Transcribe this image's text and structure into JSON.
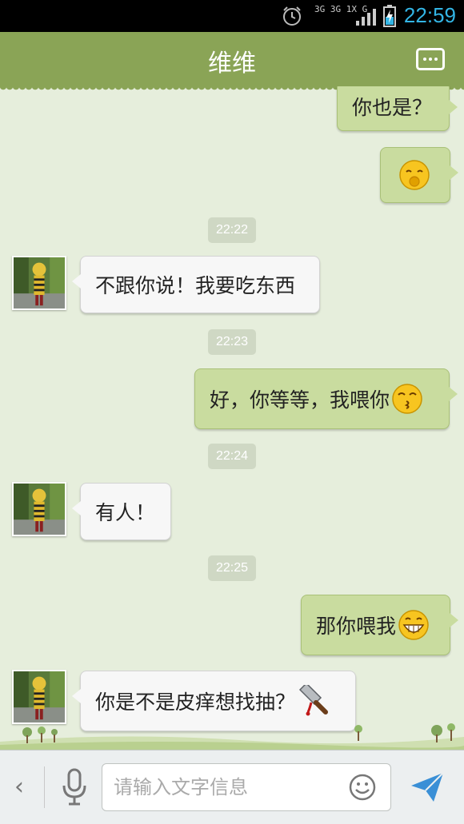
{
  "status_bar": {
    "time": "22:59",
    "network": "3G 3G 1X G",
    "icons": [
      "alarm-icon",
      "signal-icon",
      "battery-charging-icon"
    ]
  },
  "header": {
    "title": "维维",
    "menu_icon": "chat-menu-icon"
  },
  "messages": [
    {
      "type": "out",
      "text": "你也是？",
      "emoji": null
    },
    {
      "type": "out",
      "text": "",
      "emoji": "shy-smile-emoji"
    },
    {
      "type": "time",
      "text": "22:22"
    },
    {
      "type": "in",
      "text": "不跟你说！我要吃东西",
      "emoji": null
    },
    {
      "type": "time",
      "text": "22:23"
    },
    {
      "type": "out",
      "text": "好，你等等，我喂你",
      "emoji": "kiss-emoji"
    },
    {
      "type": "time",
      "text": "22:24"
    },
    {
      "type": "in",
      "text": "有人！",
      "emoji": null
    },
    {
      "type": "time",
      "text": "22:25"
    },
    {
      "type": "out",
      "text": "那你喂我",
      "emoji": "grin-emoji"
    },
    {
      "type": "in",
      "text": "你是不是皮痒想找抽？",
      "emoji": "cleaver-emoji"
    }
  ],
  "input_bar": {
    "placeholder": "请输入文字信息",
    "icons": [
      "back-arrow-icon",
      "microphone-icon",
      "smiley-icon",
      "send-icon"
    ]
  },
  "colors": {
    "header": "#8aa456",
    "outgoing_bubble": "#c9dc9f",
    "incoming_bubble": "#f7f7f7",
    "background": "#e6eedc",
    "clock": "#33b5e5"
  }
}
